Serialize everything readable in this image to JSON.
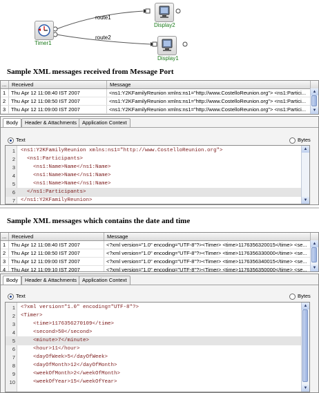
{
  "diagram": {
    "timer_label": "Timer1",
    "display_top_label": "Display2",
    "display_bottom_label": "Display1",
    "route_top_label": "route1",
    "route_bottom_label": "route2"
  },
  "section1": {
    "heading": "Sample XML messages received from Message Port",
    "columns": [
      "...",
      "Received",
      "Message"
    ],
    "rows": [
      {
        "num": "1",
        "received": "Thu Apr 12 11:08:40 IST 2007",
        "message": "<ns1:Y2KFamilyReunion xmlns:ns1=\"http://www.CostelloReunion.org\">   <ns1:Partici..."
      },
      {
        "num": "2",
        "received": "Thu Apr 12 11:08:50 IST 2007",
        "message": "<ns1:Y2KFamilyReunion xmlns:ns1=\"http://www.CostelloReunion.org\">   <ns1:Partici..."
      },
      {
        "num": "3",
        "received": "Thu Apr 12 11:09:00 IST 2007",
        "message": "<ns1:Y2KFamilyReunion xmlns:ns1=\"http://www.CostelloReunion.org\">   <ns1:Partici..."
      }
    ],
    "tabs": [
      "Body",
      "Header & Attachments",
      "Application Context"
    ],
    "radio_text": "Text",
    "radio_bytes": "Bytes",
    "code_lines": [
      {
        "n": "1",
        "t": "<ns1:Y2KFamilyReunion xmlns:ns1=\"http://www.CostelloReunion.org\">"
      },
      {
        "n": "2",
        "t": "  <ns1:Participants>"
      },
      {
        "n": "3",
        "t": "    <ns1:Name>Name</ns1:Name>"
      },
      {
        "n": "4",
        "t": "    <ns1:Name>Name</ns1:Name>"
      },
      {
        "n": "5",
        "t": "    <ns1:Name>Name</ns1:Name>"
      },
      {
        "n": "6",
        "t": "  </ns1:Participants>"
      },
      {
        "n": "7",
        "t": "</ns1:Y2KFamilyReunion>"
      }
    ]
  },
  "section2": {
    "heading": "Sample XML messages which contains the date and time",
    "columns": [
      "...",
      "Received",
      "Message"
    ],
    "rows": [
      {
        "num": "1",
        "received": "Thu Apr 12 11:08:40 IST 2007",
        "message": "<?xml version=\"1.0\" encoding=\"UTF-8\"?><Timer>   <time>1176356320015</time>   <se..."
      },
      {
        "num": "2",
        "received": "Thu Apr 12 11:08:50 IST 2007",
        "message": "<?xml version=\"1.0\" encoding=\"UTF-8\"?><Timer>   <time>1176356330000</time>   <se..."
      },
      {
        "num": "3",
        "received": "Thu Apr 12 11:09:00 IST 2007",
        "message": "<?xml version=\"1.0\" encoding=\"UTF-8\"?><Timer>   <time>1176356340015</time>   <se..."
      },
      {
        "num": "4",
        "received": "Thu Apr 12 11:09:10 IST 2007",
        "message": "<?xml version=\"1.0\" encoding=\"UTF-8\"?><Timer>   <time>1176356350000</time>   <se..."
      }
    ],
    "tabs": [
      "Body",
      "Header & Attachments",
      "Application Context"
    ],
    "radio_text": "Text",
    "radio_bytes": "Bytes",
    "code_lines": [
      {
        "n": "1",
        "t": "<?xml version=\"1.0\" encoding=\"UTF-8\"?>"
      },
      {
        "n": "2",
        "t": "<Timer>"
      },
      {
        "n": "3",
        "t": "    <time>1176356270109</time>"
      },
      {
        "n": "4",
        "t": "    <second>50</second>"
      },
      {
        "n": "5",
        "t": "    <minute>7</minute>"
      },
      {
        "n": "6",
        "t": "    <hour>11</hour>"
      },
      {
        "n": "7",
        "t": "    <dayOfWeek>5</dayOfWeek>"
      },
      {
        "n": "8",
        "t": "    <dayOfMonth>12</dayOfMonth>"
      },
      {
        "n": "9",
        "t": "    <weekOfMonth>2</weekOfMonth>"
      },
      {
        "n": "10",
        "t": "    <weekOfYear>15</weekOfYear>"
      }
    ]
  }
}
